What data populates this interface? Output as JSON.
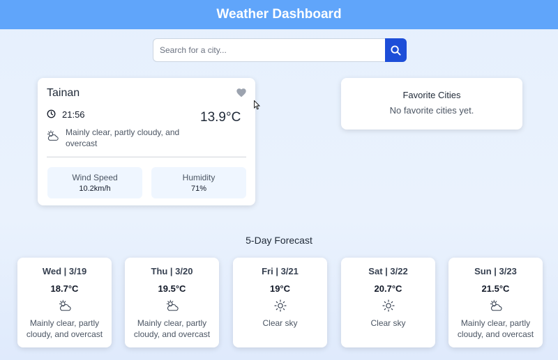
{
  "header": {
    "title": "Weather Dashboard"
  },
  "search": {
    "placeholder": "Search for a city...",
    "value": ""
  },
  "current": {
    "city": "Tainan",
    "time": "21:56",
    "temperature": "13.9°C",
    "description": "Mainly clear, partly cloudy, and overcast",
    "wind_label": "Wind Speed",
    "wind_value": "10.2km/h",
    "humidity_label": "Humidity",
    "humidity_value": "71%",
    "favorite_icon": "heart-icon",
    "weather_icon": "partly-cloudy-icon"
  },
  "favorites": {
    "title": "Favorite Cities",
    "empty_text": "No favorite cities yet."
  },
  "forecast": {
    "title": "5-Day Forecast",
    "days": [
      {
        "day": "Wed | 3/19",
        "temp": "18.7°C",
        "icon": "partly-cloudy-icon",
        "desc": "Mainly clear, partly cloudy, and overcast"
      },
      {
        "day": "Thu | 3/20",
        "temp": "19.5°C",
        "icon": "partly-cloudy-icon",
        "desc": "Mainly clear, partly cloudy, and overcast"
      },
      {
        "day": "Fri | 3/21",
        "temp": "19°C",
        "icon": "sun-icon",
        "desc": "Clear sky"
      },
      {
        "day": "Sat | 3/22",
        "temp": "20.7°C",
        "icon": "sun-icon",
        "desc": "Clear sky"
      },
      {
        "day": "Sun | 3/23",
        "temp": "21.5°C",
        "icon": "partly-cloudy-icon",
        "desc": "Mainly clear, partly cloudy, and overcast"
      }
    ]
  },
  "colors": {
    "header": "#60a5fa",
    "search_button": "#1d4ed8",
    "stat_bg": "#eff6ff"
  }
}
